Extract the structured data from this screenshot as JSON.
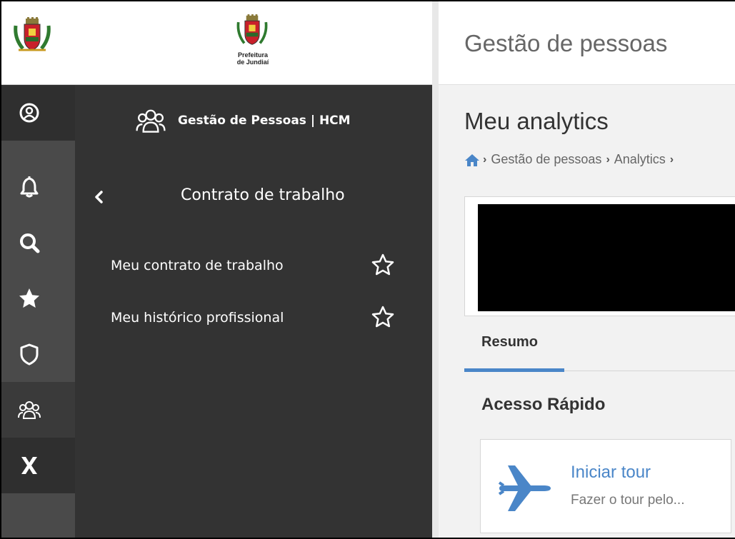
{
  "logo": {
    "org_line1": "Prefeitura",
    "org_line2": "de Jundiaí"
  },
  "rail": {
    "items": [
      {
        "icon": "user-circle-icon"
      },
      {
        "icon": "bell-icon"
      },
      {
        "icon": "search-icon"
      },
      {
        "icon": "star-icon"
      },
      {
        "icon": "shield-icon"
      },
      {
        "icon": "people-group-icon"
      },
      {
        "icon": "close-x-icon"
      }
    ]
  },
  "sidebar": {
    "module_title": "Gestão de Pessoas | HCM",
    "section_title": "Contrato de trabalho",
    "items": [
      {
        "label": "Meu contrato de trabalho"
      },
      {
        "label": "Meu histórico profissional"
      }
    ]
  },
  "header": {
    "app_title": "Gestão de pessoas"
  },
  "main": {
    "page_title": "Meu analytics",
    "breadcrumb": [
      "Gestão de pessoas",
      "Analytics"
    ],
    "tabs": [
      {
        "label": "Resumo",
        "active": true
      }
    ],
    "quick_access_title": "Acesso Rápido",
    "tour": {
      "title": "Iniciar tour",
      "subtitle": "Fazer o tour pelo..."
    }
  },
  "colors": {
    "accent": "#4a86c8",
    "sidebar_bg": "#333333",
    "rail_bg": "#4a4a4a"
  }
}
